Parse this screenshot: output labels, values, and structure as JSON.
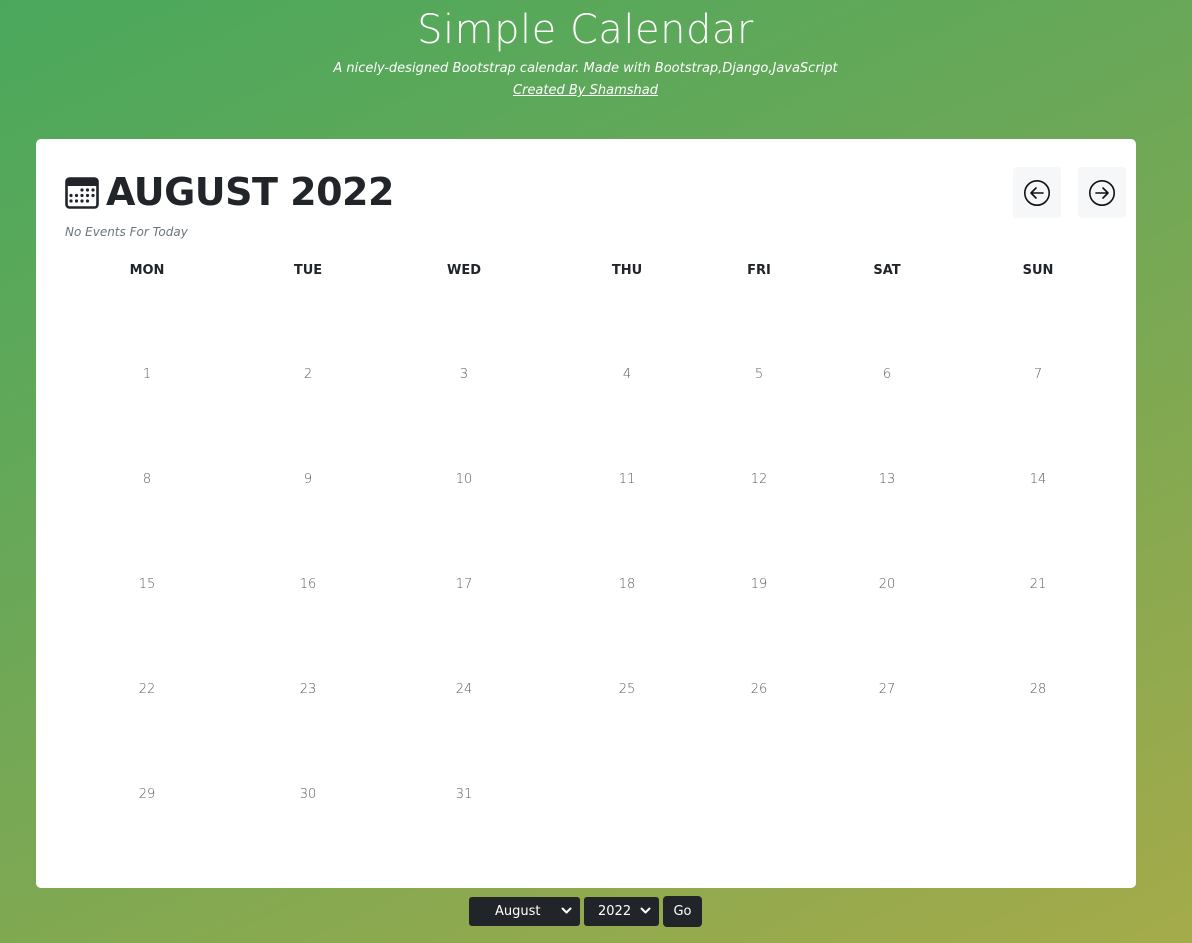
{
  "header": {
    "title": "Simple Calendar",
    "subtitle": "A nicely-designed Bootstrap calendar. Made with Bootstrap,Django,JavaScript",
    "credit": "Created By Shamshad"
  },
  "calendar": {
    "month_title": "AUGUST 2022",
    "events_note": "No Events For Today",
    "weekdays": [
      "MON",
      "TUE",
      "WED",
      "THU",
      "FRI",
      "SAT",
      "SUN"
    ],
    "weeks": [
      [
        "1",
        "2",
        "3",
        "4",
        "5",
        "6",
        "7"
      ],
      [
        "8",
        "9",
        "10",
        "11",
        "12",
        "13",
        "14"
      ],
      [
        "15",
        "16",
        "17",
        "18",
        "19",
        "20",
        "21"
      ],
      [
        "22",
        "23",
        "24",
        "25",
        "26",
        "27",
        "28"
      ],
      [
        "29",
        "30",
        "31",
        "",
        "",
        "",
        ""
      ]
    ]
  },
  "controls": {
    "month_value": "August",
    "year_value": "2022",
    "go_label": "Go"
  },
  "icons": {
    "calendar": "calendar-icon",
    "prev": "arrow-left-circle-icon",
    "next": "arrow-right-circle-icon",
    "dropdown": "chevron-down-icon"
  },
  "colors": {
    "text_dark": "#212529",
    "control_bg": "#212529",
    "nav_bg": "#f6f7f8",
    "bg_start": "#4aa85c",
    "bg_end": "#a5ab4a"
  }
}
